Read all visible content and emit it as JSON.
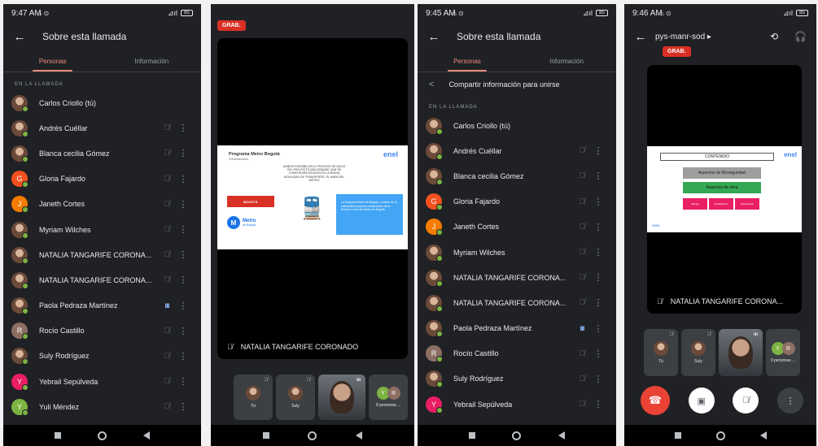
{
  "colors": {
    "background": "#202124",
    "accent": "#ea8c7d",
    "recording": "#d93025",
    "end_call": "#ea4335",
    "online_dot": "#7cb342"
  },
  "icons": {
    "back": "←",
    "mic_off": "🎙̸",
    "mic_active": "ııı",
    "kebab": "⋮",
    "share": "<",
    "forward": "▸",
    "camera_switch": "⟲",
    "audio": "🎧",
    "end_call": "☎",
    "camera_off": "▣",
    "train": "🚆"
  },
  "screen1": {
    "status": {
      "time": "9:47 AM",
      "indicators": "⌂ ⊙",
      "signal": "⊿ıl",
      "battery": "85"
    },
    "header": {
      "title": "Sobre esta llamada"
    },
    "tabs": [
      {
        "label": "Personas"
      },
      {
        "label": "Información"
      }
    ],
    "section_label": "EN LA LLAMADA",
    "participants": [
      {
        "initial": "",
        "name": "Carlos Criollo (tú)",
        "muted": false,
        "speaking": false
      },
      {
        "initial": "",
        "name": "Andrés Cuéllar",
        "muted": true,
        "speaking": false
      },
      {
        "initial": "",
        "name": "Blanca cecilia Gómez",
        "muted": true,
        "speaking": false
      },
      {
        "initial": "G",
        "name": "Gloria Fajardo",
        "muted": true,
        "speaking": false
      },
      {
        "initial": "J",
        "name": "Janeth Cortes",
        "muted": true,
        "speaking": false
      },
      {
        "initial": "",
        "name": "Myriam Wilches",
        "muted": true,
        "speaking": false
      },
      {
        "initial": "",
        "name": "NATALIA TANGARIFE CORONA...",
        "muted": true,
        "speaking": false
      },
      {
        "initial": "",
        "name": "NATALIA TANGARIFE CORONA...",
        "muted": true,
        "speaking": false
      },
      {
        "initial": "",
        "name": "Paola Pedraza Martínez",
        "muted": false,
        "speaking": true
      },
      {
        "initial": "R",
        "name": "Rocío Castillo",
        "muted": true,
        "speaking": false
      },
      {
        "initial": "",
        "name": "Suly Rodríguez",
        "muted": true,
        "speaking": false
      },
      {
        "initial": "Y",
        "name": "Yebrail Sepúlveda",
        "muted": true,
        "speaking": false
      },
      {
        "initial": "Y",
        "name": "Yuli Méndez",
        "muted": true,
        "speaking": false
      }
    ]
  },
  "screen2": {
    "rec_label": "GRAB.",
    "slide": {
      "title": "Programa Metro Bogotá",
      "subtitle": "Presentaciones",
      "logo": "enel",
      "text": "UNIDOS ESCRIBILOS EL PROCESO SE INICIO DEL PROYECTO MÁS GRANDE QUE SE CONSTRUIRÁ EN BOGOTÁ LA NUEVA MOVILIDAD DE TRANSPORTE, EL MAPA DEL METRO",
      "bogota_logo": "BOGOTÁ",
      "metro_logo": "Metro",
      "metro_sub": "de Bogotá",
      "box_text": "La Empresa Metro de Bogotá, a través de la interventoría para la construcción de la Primera Línea de Metro de Bogotá."
    },
    "presenter": "NATALIA TANGARIFE CORONADO",
    "thumbs": {
      "self": "Tú",
      "suly": "Suly",
      "more": "9 personas ..."
    },
    "more_initials": [
      "Y",
      "R"
    ]
  },
  "screen3": {
    "status": {
      "time": "9:45 AM",
      "indicators": "⌂ ⊙",
      "signal": "⊿ıl",
      "battery": "85"
    },
    "header": {
      "title": "Sobre esta llamada"
    },
    "tabs": [
      {
        "label": "Personas"
      },
      {
        "label": "Información"
      }
    ],
    "share_label": "Compartir información para unirse",
    "section_label": "EN LA LLAMADA"
  },
  "screen4": {
    "status": {
      "time": "9:46 AM",
      "indicators": "⌂ ⊙",
      "signal": "⊿ıl",
      "battery": "85"
    },
    "call_code": "pys-manr-sod",
    "rec_label": "GRAB.",
    "slide": {
      "content_label": "CONTENIDO",
      "logo": "enel",
      "grey_button": "Aspectos de Bioseguridad",
      "green_button": "Aspectos de obra",
      "pink_buttons": [
        "Manejo",
        "Señalización",
        "Dispositivos"
      ],
      "footer_logo": "ENEL"
    },
    "presenter": "NATALIA TANGARIFE CORONA...",
    "thumbs": {
      "self": "Tú",
      "suly": "Suly",
      "more": "9 personas ..."
    },
    "more_initials": [
      "Y",
      "R"
    ]
  }
}
